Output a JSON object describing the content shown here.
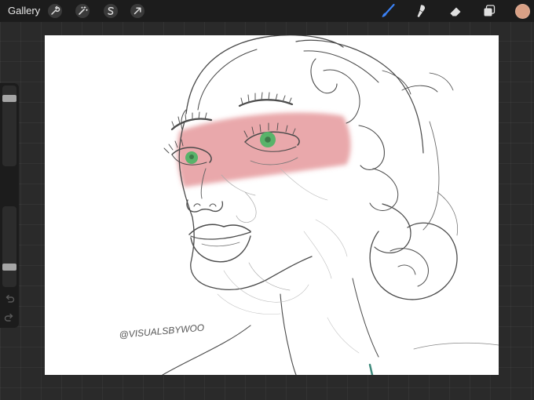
{
  "topbar": {
    "gallery_label": "Gallery",
    "left_tools": [
      "wrench-icon",
      "magic-wand-icon",
      "selection-s-icon",
      "transform-arrow-icon"
    ],
    "right_tools": [
      "brush-icon",
      "smudge-icon",
      "eraser-icon",
      "layers-icon"
    ],
    "active_tool": "brush-icon",
    "active_color": "#d9a085"
  },
  "sidebar": {
    "brush_size_fraction": 0.9,
    "opacity_fraction": 0.2,
    "actions": [
      "undo-icon",
      "redo-icon"
    ]
  },
  "canvas": {
    "background": "#ffffff",
    "signature": "@VISUALSBYWOO"
  },
  "colors": {
    "ui_bar": "#1c1c1c",
    "workspace": "#2a2a2a",
    "accent_blue": "#3b82f6",
    "eye_wash": "#d9696e",
    "iris": "#59b36a"
  }
}
